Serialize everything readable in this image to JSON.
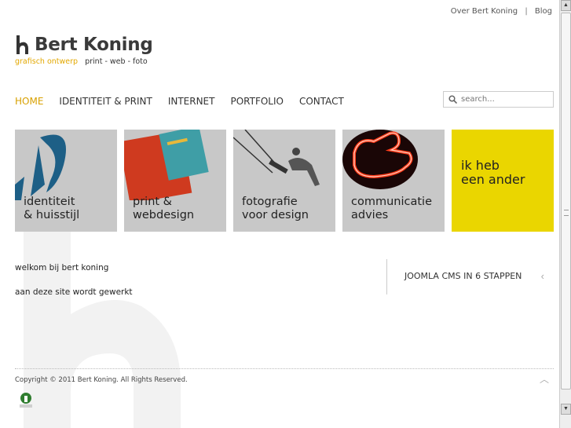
{
  "toplinks": {
    "about": "Over Bert Koning",
    "separator": "|",
    "blog": "Blog"
  },
  "logo": {
    "name": "Bert Koning",
    "tagline_a": "grafisch ontwerp",
    "tagline_b": "print - web - foto"
  },
  "nav": [
    {
      "label": "HOME",
      "active": true
    },
    {
      "label": "IDENTITEIT & PRINT",
      "active": false
    },
    {
      "label": "INTERNET",
      "active": false
    },
    {
      "label": "PORTFOLIO",
      "active": false
    },
    {
      "label": "CONTACT",
      "active": false
    }
  ],
  "search": {
    "placeholder": "search..."
  },
  "tiles": [
    {
      "label": "identiteit\n& huisstijl",
      "icon": "identity-logo-image"
    },
    {
      "label": "print &\nwebdesign",
      "icon": "print-cards-image"
    },
    {
      "label": "fotografie\nvoor design",
      "icon": "swing-photo-image"
    },
    {
      "label": "communicatie\nadvies",
      "icon": "neon-thumb-image"
    },
    {
      "label": "ik heb\neen ander",
      "icon": ""
    }
  ],
  "content": {
    "welcome": "welkom bij bert koning",
    "notice": "aan deze site wordt gewerkt"
  },
  "sidebar": {
    "link": "JOOMLA CMS IN 6 STAPPEN",
    "chevron": "‹"
  },
  "footer": {
    "copyright": "Copyright © 2011 Bert Koning. All Rights Reserved.",
    "top_arrow": "︿"
  },
  "colors": {
    "accent": "#d8a000",
    "tile_gray": "#c8c8c8",
    "tile_yellow": "#ead600"
  }
}
